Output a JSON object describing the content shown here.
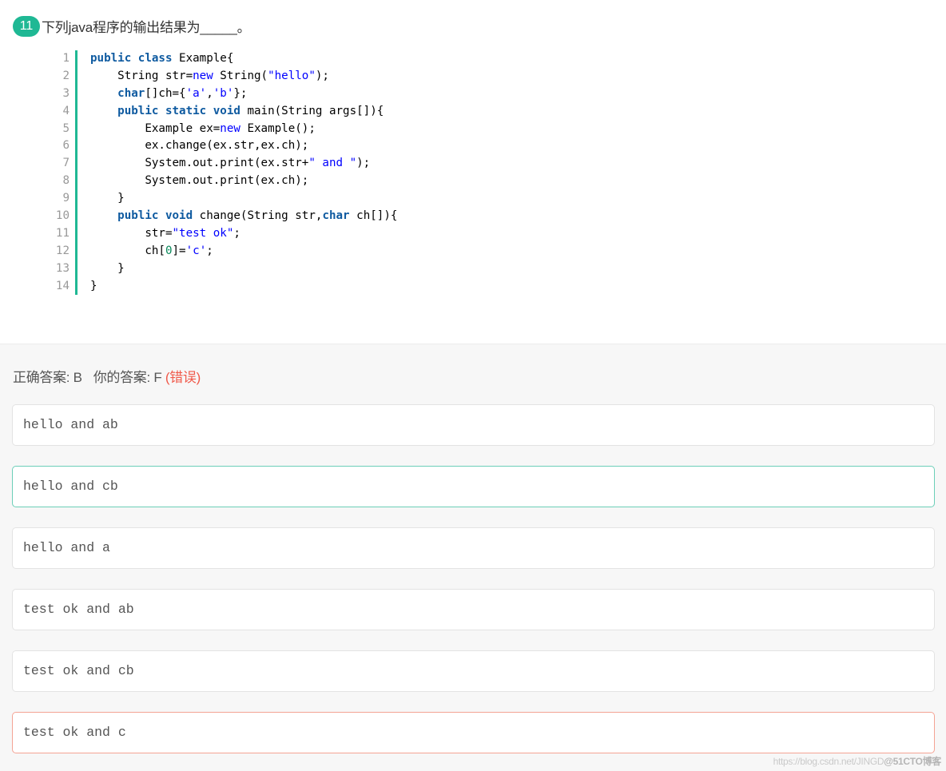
{
  "question": {
    "number": "11",
    "text": "下列java程序的输出结果为_____。"
  },
  "code": {
    "language": "java",
    "accent_color": "#1fb894",
    "lines": [
      {
        "n": "1",
        "tokens": [
          {
            "t": "public class",
            "c": "kw"
          },
          {
            "t": " Example{",
            "c": ""
          }
        ]
      },
      {
        "n": "2",
        "tokens": [
          {
            "t": "    String str=",
            "c": ""
          },
          {
            "t": "new",
            "c": "kw2"
          },
          {
            "t": " String(",
            "c": ""
          },
          {
            "t": "\"hello\"",
            "c": "str"
          },
          {
            "t": ");",
            "c": ""
          }
        ]
      },
      {
        "n": "3",
        "tokens": [
          {
            "t": "    ",
            "c": ""
          },
          {
            "t": "char",
            "c": "kw"
          },
          {
            "t": "[]ch={",
            "c": ""
          },
          {
            "t": "'a'",
            "c": "str"
          },
          {
            "t": ",",
            "c": ""
          },
          {
            "t": "'b'",
            "c": "str"
          },
          {
            "t": "};",
            "c": ""
          }
        ]
      },
      {
        "n": "4",
        "tokens": [
          {
            "t": "    ",
            "c": ""
          },
          {
            "t": "public static void",
            "c": "kw"
          },
          {
            "t": " main(String args[]){",
            "c": ""
          }
        ]
      },
      {
        "n": "5",
        "tokens": [
          {
            "t": "        Example ex=",
            "c": ""
          },
          {
            "t": "new",
            "c": "kw2"
          },
          {
            "t": " Example();",
            "c": ""
          }
        ]
      },
      {
        "n": "6",
        "tokens": [
          {
            "t": "        ex.change(ex.str,ex.ch);",
            "c": ""
          }
        ]
      },
      {
        "n": "7",
        "tokens": [
          {
            "t": "        System.out.print(ex.str+",
            "c": ""
          },
          {
            "t": "\" and \"",
            "c": "str"
          },
          {
            "t": ");",
            "c": ""
          }
        ]
      },
      {
        "n": "8",
        "tokens": [
          {
            "t": "        System.out.print(ex.ch);",
            "c": ""
          }
        ]
      },
      {
        "n": "9",
        "tokens": [
          {
            "t": "    }",
            "c": ""
          }
        ]
      },
      {
        "n": "10",
        "tokens": [
          {
            "t": "    ",
            "c": ""
          },
          {
            "t": "public void",
            "c": "kw"
          },
          {
            "t": " change(String str,",
            "c": ""
          },
          {
            "t": "char",
            "c": "kw"
          },
          {
            "t": " ch[]){",
            "c": ""
          }
        ]
      },
      {
        "n": "11",
        "tokens": [
          {
            "t": "        str=",
            "c": ""
          },
          {
            "t": "\"test ok\"",
            "c": "str"
          },
          {
            "t": ";",
            "c": ""
          }
        ]
      },
      {
        "n": "12",
        "tokens": [
          {
            "t": "        ch[",
            "c": ""
          },
          {
            "t": "0",
            "c": "num"
          },
          {
            "t": "]=",
            "c": ""
          },
          {
            "t": "'c'",
            "c": "str"
          },
          {
            "t": ";",
            "c": ""
          }
        ]
      },
      {
        "n": "13",
        "tokens": [
          {
            "t": "    }",
            "c": ""
          }
        ]
      },
      {
        "n": "14",
        "tokens": [
          {
            "t": "}",
            "c": ""
          }
        ]
      }
    ]
  },
  "result": {
    "correct_label": "正确答案: B",
    "your_label": "你的答案: F",
    "status": "(错误)",
    "status_color": "#f0594a"
  },
  "options": [
    {
      "text": "hello and ab",
      "state": "normal"
    },
    {
      "text": "hello and cb",
      "state": "correct"
    },
    {
      "text": "hello and a",
      "state": "normal"
    },
    {
      "text": "test ok and ab",
      "state": "normal"
    },
    {
      "text": "test ok and cb",
      "state": "normal"
    },
    {
      "text": "test ok and c",
      "state": "selected-wrong"
    }
  ],
  "colors": {
    "correct_border": "#6ccfb8",
    "wrong_border": "#f4a394",
    "badge": "#1fb894"
  },
  "watermark": {
    "url": "https://blog.csdn.net/JINGD",
    "brand": "@51CTO博客"
  }
}
